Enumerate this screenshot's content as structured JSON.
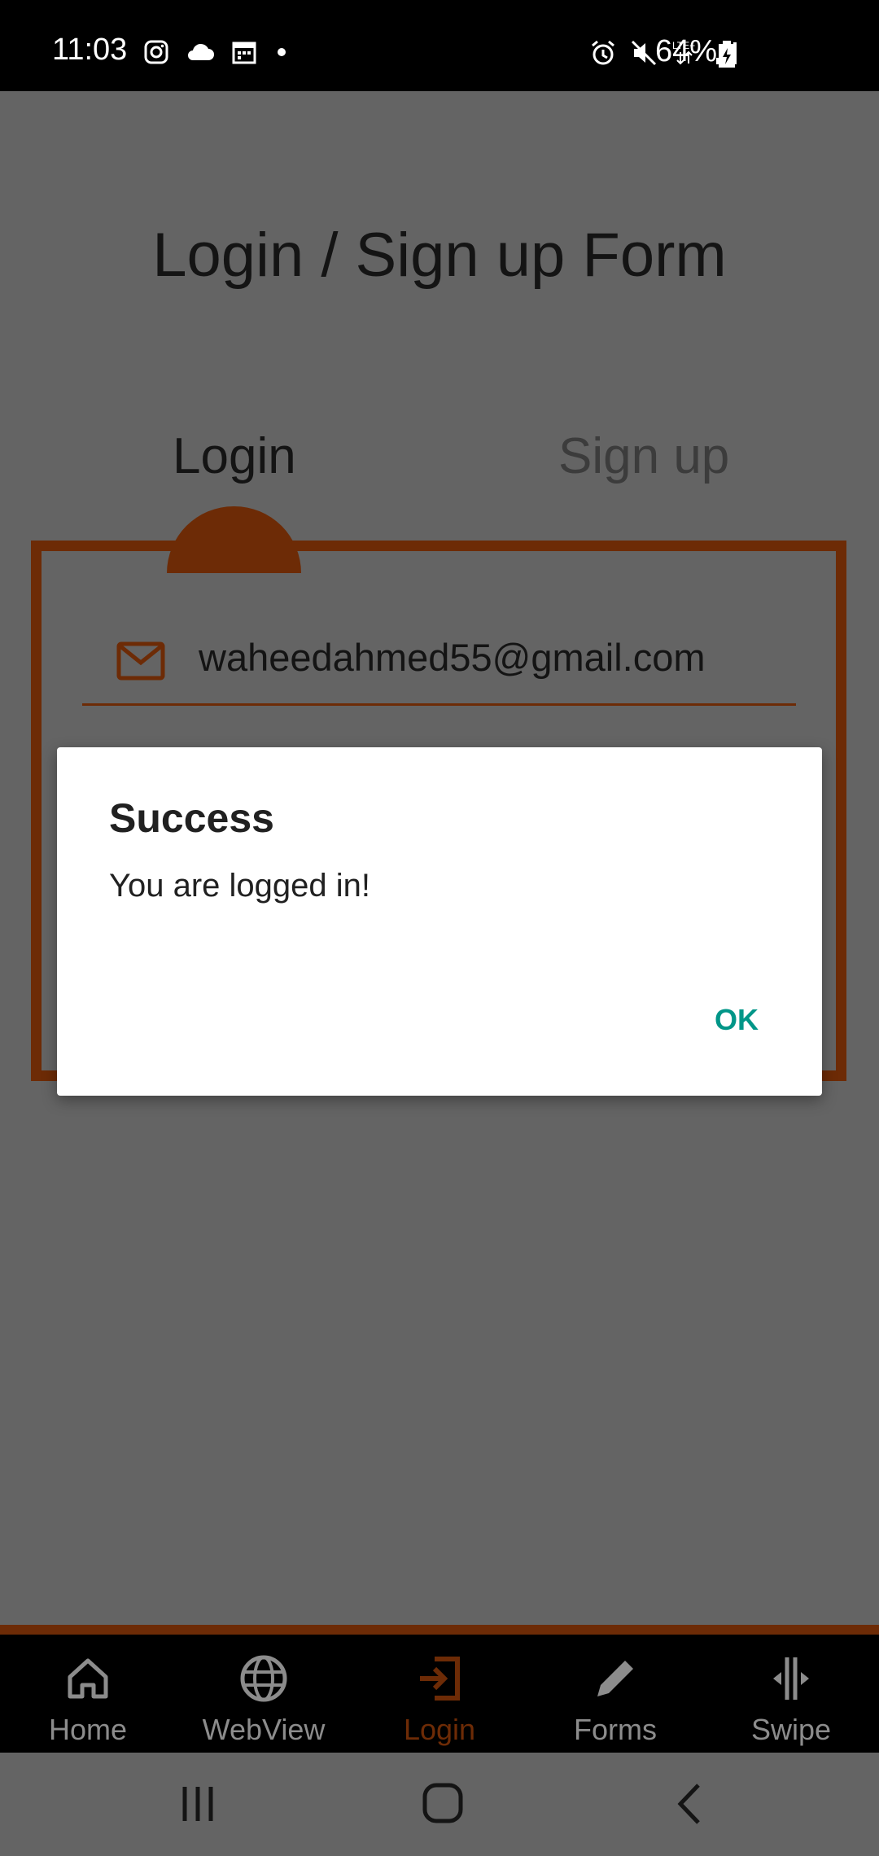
{
  "status_bar": {
    "time": "11:03",
    "battery": "64%",
    "left_icons": [
      "instagram-icon",
      "cloud-icon",
      "calendar-icon",
      "dot-icon"
    ],
    "right_icons": [
      "alarm-icon",
      "mute-icon",
      "lte-signal-icon",
      "signal-bars-icon",
      "battery-charging-icon"
    ]
  },
  "page": {
    "title": "Login / Sign up Form"
  },
  "tabs": {
    "login": "Login",
    "signup": "Sign up",
    "active": "login"
  },
  "form": {
    "email_value": "waheedahmed55@gmail.com",
    "email_icon": "mail-icon"
  },
  "dialog": {
    "title": "Success",
    "message": "You are logged in!",
    "ok_label": "OK"
  },
  "bottom_nav": {
    "items": [
      {
        "label": "Home",
        "icon": "home-icon"
      },
      {
        "label": "WebView",
        "icon": "globe-icon"
      },
      {
        "label": "Login",
        "icon": "login-icon"
      },
      {
        "label": "Forms",
        "icon": "pencil-icon"
      },
      {
        "label": "Swipe",
        "icon": "swipe-icon"
      }
    ],
    "active": "Login"
  },
  "system_nav": [
    "recents-button",
    "home-button",
    "back-button"
  ],
  "colors": {
    "accent": "#6d2b06",
    "dialog_button": "#009688",
    "scrim_background": "#646464"
  }
}
